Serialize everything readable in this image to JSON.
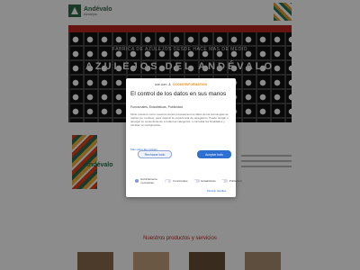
{
  "site": {
    "logo_name": "Andévalo",
    "logo_sub": "Azulejos",
    "nav": [
      "",
      "",
      "",
      ""
    ],
    "hero_tag": "FABRICA DE AZULEJOS DESDE HACE MAS DE MEDIO",
    "hero_title": "AZULEJOS DEL ANDÉVALO",
    "promo_brand": "Andévalo",
    "products_title": "Nuestros productos y servicios"
  },
  "consent": {
    "powered_left": "one.com",
    "powered_sep": "&",
    "powered_right": "COOKIEINFORMATION",
    "title": "El control de los datos en sus manos",
    "tabs": "Funcionales, Estadísticas, Publicidad",
    "body": "Tanto nosotros como nuestros socios procesamos los datos de las tecnologías de rastreo (ej. cookies), para mejorar su experiencia de navegación. Puede otorgar o denegar su consentimiento a todas las categorías, o consultar las finalidades y cambiar su configuración.",
    "link_label": "Más sobre las cookies",
    "btn_deny": "Rechazar todo",
    "btn_accept": "Aceptar todo",
    "toggles": [
      {
        "label": "Estrictamente necesarias",
        "on": true
      },
      {
        "label": "Funcionales",
        "on": false
      },
      {
        "label": "Estadísticas",
        "on": false
      },
      {
        "label": "Publicidad",
        "on": false
      }
    ],
    "show_details": "Mostrar detalles"
  },
  "colors": {
    "brand_green": "#2f6b4c",
    "nav_red": "#b8261d",
    "accept_blue": "#2e6fd0"
  }
}
